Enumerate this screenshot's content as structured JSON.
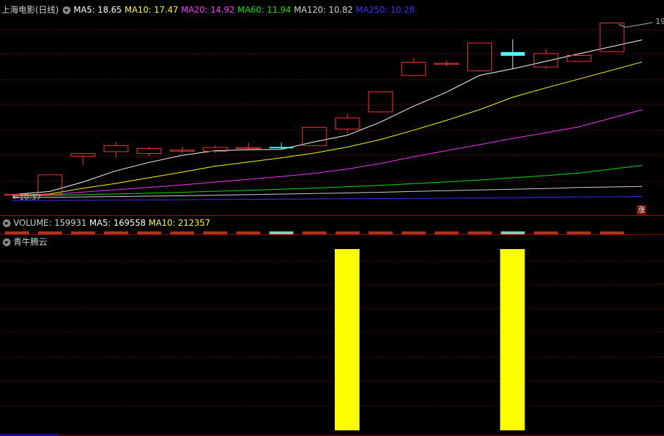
{
  "main_legend": {
    "title": "上海电影(日线)",
    "ma5": "MA5: 18.65",
    "ma10": "MA10: 17.47",
    "ma20": "MA20: 14.92",
    "ma60": "MA60: 11.94",
    "ma120": "MA120: 10.82",
    "ma250": "MA250: 10.28"
  },
  "volume_legend": {
    "volume": "VOLUME: 159931",
    "ma5": "MA5: 169558",
    "ma10": "MA10: 212357"
  },
  "indicator_legend": {
    "title": "青牛腾云"
  },
  "price_labels": {
    "low": "10.37",
    "high": "19."
  },
  "badge": "涨",
  "colors": {
    "up": "#ff3232",
    "down": "#54ffff",
    "ma5": "#ffffff",
    "ma10": "#ffff00",
    "ma20": "#ff32ff",
    "ma60": "#00e600",
    "ma120": "#d2d2d2",
    "ma250": "#3232ff",
    "indicator": "#ffff00",
    "grid": "#8a0000"
  },
  "chart_data": {
    "type": "candlestick",
    "price_range": [
      10.0,
      19.8
    ],
    "candles": [
      {
        "o": 10.37,
        "h": 10.44,
        "l": 10.32,
        "c": 10.4
      },
      {
        "o": 10.4,
        "h": 11.44,
        "l": 10.4,
        "c": 11.44
      },
      {
        "o": 12.44,
        "h": 12.6,
        "l": 11.95,
        "c": 12.58
      },
      {
        "o": 12.68,
        "h": 13.18,
        "l": 12.35,
        "c": 13.0
      },
      {
        "o": 12.58,
        "h": 12.95,
        "l": 12.45,
        "c": 12.85
      },
      {
        "o": 12.76,
        "h": 12.94,
        "l": 12.6,
        "c": 12.76
      },
      {
        "o": 12.7,
        "h": 13.0,
        "l": 12.6,
        "c": 12.9
      },
      {
        "o": 12.9,
        "h": 13.15,
        "l": 12.8,
        "c": 12.9
      },
      {
        "o": 12.93,
        "h": 13.16,
        "l": 12.8,
        "c": 12.86
      },
      {
        "o": 13.0,
        "h": 14.0,
        "l": 13.0,
        "c": 13.98
      },
      {
        "o": 13.88,
        "h": 14.72,
        "l": 13.65,
        "c": 14.48
      },
      {
        "o": 14.8,
        "h": 15.88,
        "l": 14.75,
        "c": 15.88
      },
      {
        "o": 16.75,
        "h": 17.7,
        "l": 16.7,
        "c": 17.45
      },
      {
        "o": 17.4,
        "h": 17.55,
        "l": 17.22,
        "c": 17.4
      },
      {
        "o": 17.0,
        "h": 18.48,
        "l": 16.95,
        "c": 18.48
      },
      {
        "o": 18.0,
        "h": 18.68,
        "l": 17.12,
        "c": 17.8
      },
      {
        "o": 17.2,
        "h": 18.17,
        "l": 17.1,
        "c": 17.92
      },
      {
        "o": 17.5,
        "h": 17.95,
        "l": 17.45,
        "c": 17.82
      },
      {
        "o": 18.02,
        "h": 19.55,
        "l": 18.02,
        "c": 19.55
      }
    ],
    "ma_lines": {
      "ma5": [
        10.38,
        10.55,
        11.05,
        11.65,
        12.1,
        12.48,
        12.73,
        12.78,
        12.8,
        13.2,
        13.55,
        14.25,
        15.1,
        15.85,
        16.75,
        17.1,
        17.5,
        17.9,
        18.65
      ],
      "ma10": [
        10.33,
        10.42,
        10.72,
        10.98,
        11.28,
        11.58,
        11.9,
        12.12,
        12.35,
        12.6,
        12.92,
        13.32,
        13.82,
        14.35,
        14.92,
        15.58,
        16.08,
        16.55,
        17.47
      ],
      "ma20": [
        10.31,
        10.38,
        10.52,
        10.64,
        10.77,
        10.9,
        11.05,
        11.2,
        11.35,
        11.52,
        11.75,
        12.04,
        12.4,
        12.73,
        13.05,
        13.38,
        13.68,
        14.0,
        14.92
      ],
      "ma60": [
        10.3,
        10.34,
        10.38,
        10.42,
        10.46,
        10.51,
        10.56,
        10.61,
        10.67,
        10.73,
        10.8,
        10.88,
        10.97,
        11.06,
        11.16,
        11.28,
        11.4,
        11.53,
        11.94
      ],
      "ma120": [
        10.22,
        10.24,
        10.26,
        10.28,
        10.3,
        10.32,
        10.35,
        10.38,
        10.41,
        10.44,
        10.47,
        10.51,
        10.55,
        10.59,
        10.63,
        10.67,
        10.71,
        10.76,
        10.82
      ],
      "ma250": [
        10.06,
        10.07,
        10.08,
        10.09,
        10.1,
        10.11,
        10.12,
        10.13,
        10.14,
        10.15,
        10.16,
        10.17,
        10.18,
        10.19,
        10.21,
        10.22,
        10.24,
        10.26,
        10.28
      ]
    },
    "indicator": {
      "active": [
        false,
        false,
        false,
        false,
        false,
        false,
        false,
        false,
        false,
        false,
        true,
        false,
        false,
        false,
        false,
        true,
        false,
        false,
        false
      ]
    }
  }
}
